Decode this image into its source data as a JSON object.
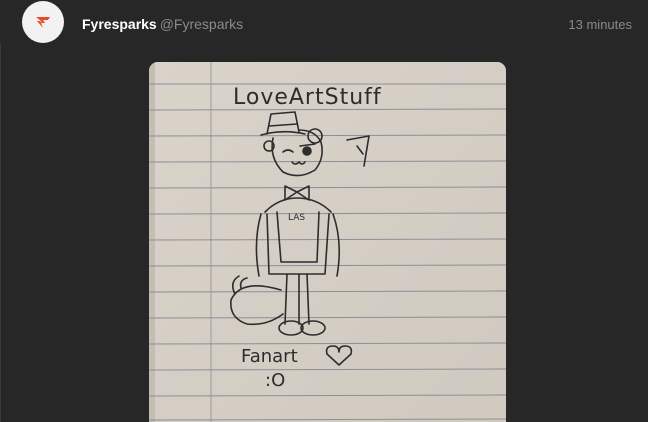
{
  "post": {
    "author": {
      "display_name": "Fyresparks",
      "handle": "@Fyresparks",
      "avatar_icon": "fyresparks-logo-icon",
      "avatar_accent": "#e8492e"
    },
    "timestamp": "13 minutes",
    "media": {
      "kind": "photo-of-notebook-sketch",
      "handwritten_title": "LoveArtStuff",
      "handwritten_caption": "Fanart",
      "handwritten_emote": ":O",
      "sketch_shirt_text": "LAS"
    }
  },
  "colors": {
    "background": "#272727",
    "display_name": "#ffffff",
    "muted_text": "#8a8a8a",
    "paper": "#d7d1c8",
    "ruling": "#8e8e96",
    "pencil": "#2d2d2d"
  }
}
